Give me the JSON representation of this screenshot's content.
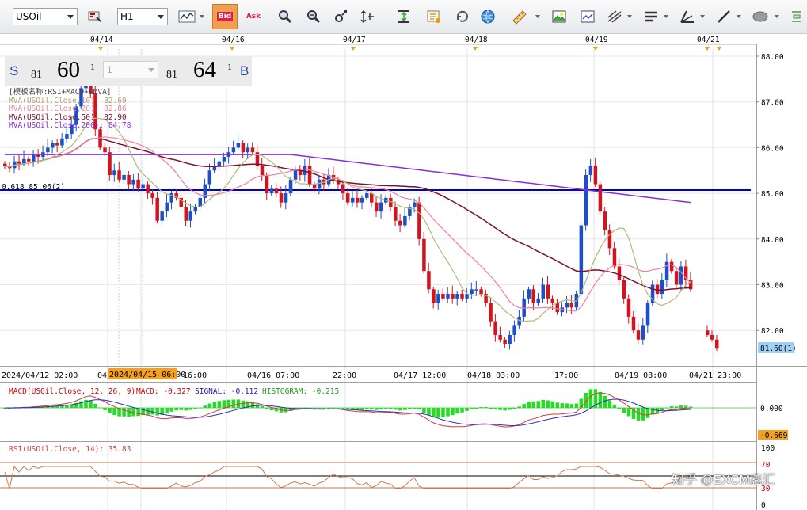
{
  "toolbar": {
    "symbol": "USOil",
    "timeframe": "H1",
    "bid_label": "Bid",
    "ask_label": "Ask",
    "icons": [
      "chart-type-icon",
      "bid-icon",
      "ask-icon",
      "zoom-in-icon",
      "zoom-out-icon",
      "pan-icon",
      "price-scale-icon",
      "period-sep-icon",
      "template-icon",
      "refresh-icon",
      "globe-icon",
      "ruler-icon",
      "picture-icon",
      "chart-image-icon",
      "fib-icon",
      "lines-icon",
      "trendline-icon",
      "line-draw-icon",
      "shape-icon"
    ]
  },
  "quote": {
    "sell_letter": "S",
    "sell_prefix": "81",
    "sell_big": "60",
    "sell_sup": "1",
    "lot_value": "1",
    "buy_prefix": "81",
    "buy_big": "64",
    "buy_sup": "1",
    "buy_letter": "B"
  },
  "legend": {
    "template": "[模板名称:RSI+MACD+&MVA]",
    "ma10": "MVA(USOil.Close,10): 82.69",
    "ma20": "MVA(USOil.Close,20): 82.86",
    "ma50": "MVA(USOil.Close,50): 82.90",
    "ma200": "MVA(USOil.Close,200): 84.78"
  },
  "top_dates": [
    "04/14",
    "04/16",
    "04/17",
    "04/18",
    "04/19",
    "04/21"
  ],
  "price_axis": [
    "88.00",
    "87.00",
    "86.00",
    "85.00",
    "84.00",
    "83.00",
    "82.00"
  ],
  "last_price_label": "81.60(1)",
  "fib_label": "0.618 85.06(2)",
  "time_axis": [
    "2024/04/12 02:00",
    "04/",
    "16:00",
    "04/16 07:00",
    "22:00",
    "04/17 12:00",
    "04/18 03:00",
    "17:00",
    "04/19 08:00",
    "04/21 23:00"
  ],
  "time_highlight": "2024/04/15 06:00",
  "macd": {
    "title": "MACD(USOil.Close, 12, 26, 9)",
    "macd_label": "MACD: -0.327",
    "signal_label": "SIGNAL: -0.112",
    "hist_label": "HISTOGRAM: -0.215",
    "axis_zero": "0.000",
    "axis_value": "-0.669"
  },
  "rsi": {
    "title": "RSI(USOil.Close, 14): 35.83",
    "axis_100": "100",
    "axis_70": "70",
    "axis_30": "30",
    "axis_0": "0"
  },
  "watermark": "知乎 @EXCM鑫汇",
  "colors": {
    "bull": "#1e4fc8",
    "bear": "#d2141e",
    "ma10": "#b5b87a",
    "ma20": "#f07fa0",
    "ma50": "#7a1030",
    "ma200": "#8a2be2",
    "fib": "#0000cc",
    "macd_line": "#d43a3a",
    "signal_line": "#3030c0",
    "hist": "#22dd22"
  }
}
